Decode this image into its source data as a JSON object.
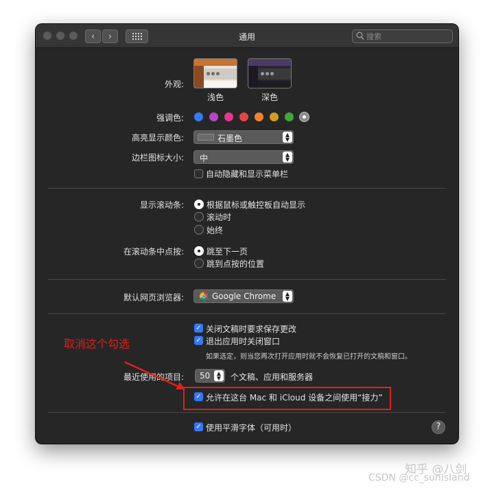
{
  "window": {
    "title": "通用",
    "search_placeholder": "搜索"
  },
  "appearance": {
    "label": "外观:",
    "options": [
      "浅色",
      "深色"
    ],
    "selected": "浅色"
  },
  "accent": {
    "label": "强调色:",
    "colors": [
      "#2f7ef5",
      "#b847c7",
      "#e8368c",
      "#e54645",
      "#f3802f",
      "#d49a23",
      "#3fa83a",
      "#8c8c8c"
    ],
    "selected_index": 7
  },
  "highlight": {
    "label": "高亮显示颜色:",
    "value": "石墨色"
  },
  "sidebar_icon_size": {
    "label": "边栏图标大小:",
    "value": "中"
  },
  "autohide_menubar": {
    "label": "自动隐藏和显示菜单栏",
    "checked": false
  },
  "scrollbars": {
    "label": "显示滚动条:",
    "options": [
      "根据鼠标或触控板自动显示",
      "滚动时",
      "始终"
    ],
    "selected_index": 0
  },
  "click_scrollbar": {
    "label": "在滚动条中点按:",
    "options": [
      "跳至下一页",
      "跳到点按的位置"
    ],
    "selected_index": 0
  },
  "browser": {
    "label": "默认网页浏览器:",
    "value": "Google Chrome"
  },
  "documents": {
    "ask_save": {
      "label": "关闭文稿时要求保存更改",
      "checked": true
    },
    "close_windows": {
      "label": "退出应用时关闭窗口",
      "checked": true
    },
    "note": "如果选定，则当您再次打开应用时就不会恢复已打开的文稿和窗口。"
  },
  "recent_items": {
    "label": "最近使用的项目:",
    "value": "50",
    "suffix": "个文稿、应用和服务器"
  },
  "handoff": {
    "label": "允许在这台 Mac 和 iCloud 设备之间使用“接力”",
    "checked": true
  },
  "font_smoothing": {
    "label": "使用平滑字体（可用时）",
    "checked": true
  },
  "annotation": {
    "text": "取消这个勾选",
    "color": "#e0201c"
  },
  "watermarks": {
    "zhihu": "知乎 @八剑",
    "csdn": "CSDN @cc_sunIsland"
  }
}
